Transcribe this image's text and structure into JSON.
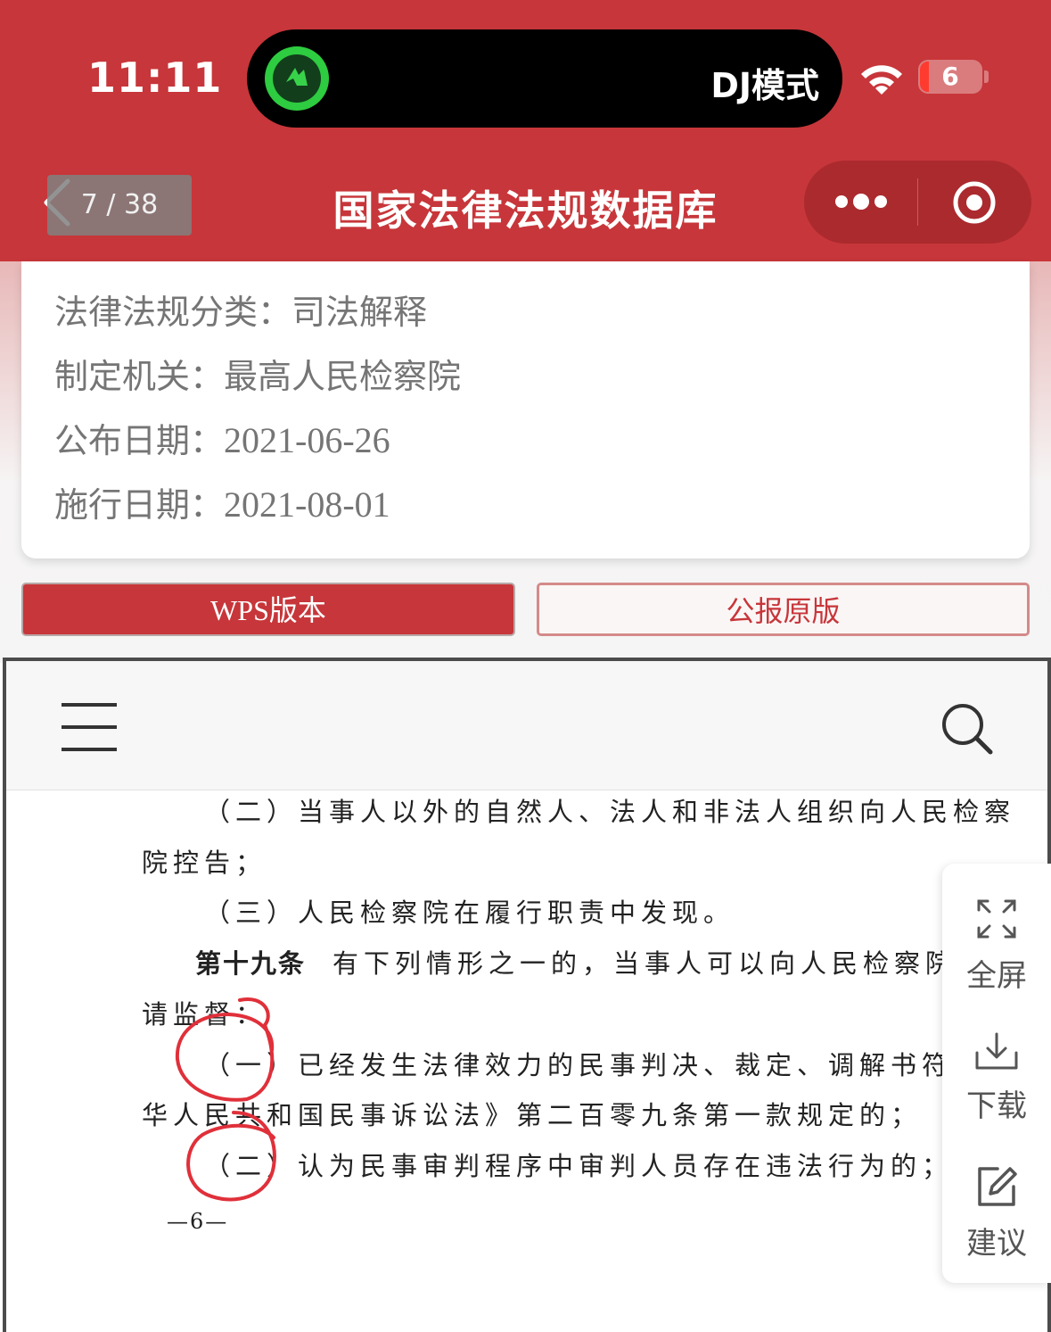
{
  "status_bar": {
    "time": "11:11",
    "island_label": "DJ模式",
    "battery_level": "6"
  },
  "nav": {
    "title": "国家法律法规数据库"
  },
  "info": {
    "category_label": "法律法规分类：",
    "category_value": "司法解释",
    "authority_label": "制定机关：",
    "authority_value": "最高人民检察院",
    "publish_label": "公布日期：",
    "publish_value": "2021-06-26",
    "effective_label": "施行日期：",
    "effective_value": "2021-08-01"
  },
  "buttons": {
    "wps_prefix": "WPS",
    "wps_suffix": "版本",
    "original": "公报原版"
  },
  "viewer": {
    "page_indicator": "7 / 38",
    "lines": [
      "（二）当事人以外的自然人、法人和非法人组织向人民检察",
      "院控告；",
      "（三）人民检察院在履行职责中发现。",
      "第十九条",
      "有下列情形之一的，当事人可以向人民检察院申",
      "请监督：",
      "（一）已经发生法律效力的民事判决、裁定、调解书符合《中",
      "华人民共和国民事诉讼法》第二百零九条第一款规定的；",
      "（二）认为民事审判程序中审判人员存在违法行为的；",
      "—6—"
    ]
  },
  "sidebar": {
    "fullscreen": "全屏",
    "download": "下载",
    "suggest": "建议"
  },
  "colors": {
    "brand_red": "#c7363a",
    "annotation_red": "#e0303a"
  }
}
